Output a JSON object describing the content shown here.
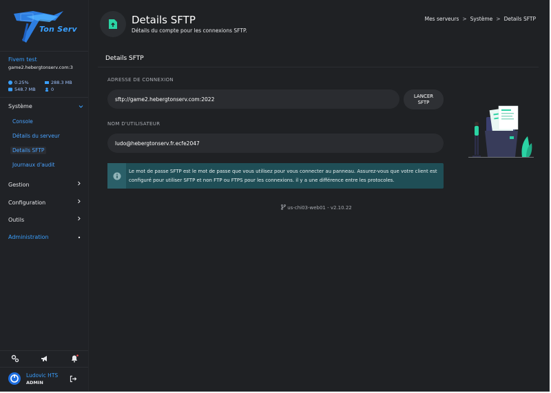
{
  "brand": {
    "logo_text": "Ton Serv"
  },
  "server": {
    "name": "Fivem test",
    "host": "game2.hebergtonserv.com:3",
    "cpu": "0.25%",
    "memory": "288.3 MB",
    "disk": "548.7 MB",
    "players": "0"
  },
  "nav": {
    "systeme": "Système",
    "items": [
      "Console",
      "Détails du serveur",
      "Details SFTP",
      "Journaux d'audit"
    ],
    "gestion": "Gestion",
    "configuration": "Configuration",
    "outils": "Outils",
    "administration": "Administration"
  },
  "user": {
    "name": "Ludovic HTS",
    "role": "ADMIN"
  },
  "header": {
    "title": "Details SFTP",
    "subtitle": "Détails du compte pour les connexions SFTP.",
    "breadcrumb": [
      "Mes serveurs",
      "Système",
      "Details SFTP"
    ],
    "breadcrumb_sep": ">"
  },
  "card": {
    "title": "Details SFTP",
    "address_label": "ADRESSE DE CONNEXION",
    "address_value": "sftp://game2.hebergtonserv.com:2022",
    "launch_label_1": "LANCER",
    "launch_label_2": "SFTP",
    "username_label": "NOM D'UTILISATEUR",
    "username_value": "ludo@hebergtonserv.fr.ecfe2047",
    "alert_text": "Le mot de passe SFTP est le mot de passe que vous utilisez pour vous connecter au panneau. Assurez-vous que votre client est configuré pour utiliser SFTP et non FTP ou FTPS pour les connexions. il y a une différence entre les protocoles."
  },
  "footer": {
    "version": "us-chi03-web01 - v2.10.22"
  },
  "colors": {
    "accent": "#3aa0ff",
    "background": "#1f2124",
    "alert": "#1f4e56",
    "icon_green": "#2bd3a4"
  }
}
